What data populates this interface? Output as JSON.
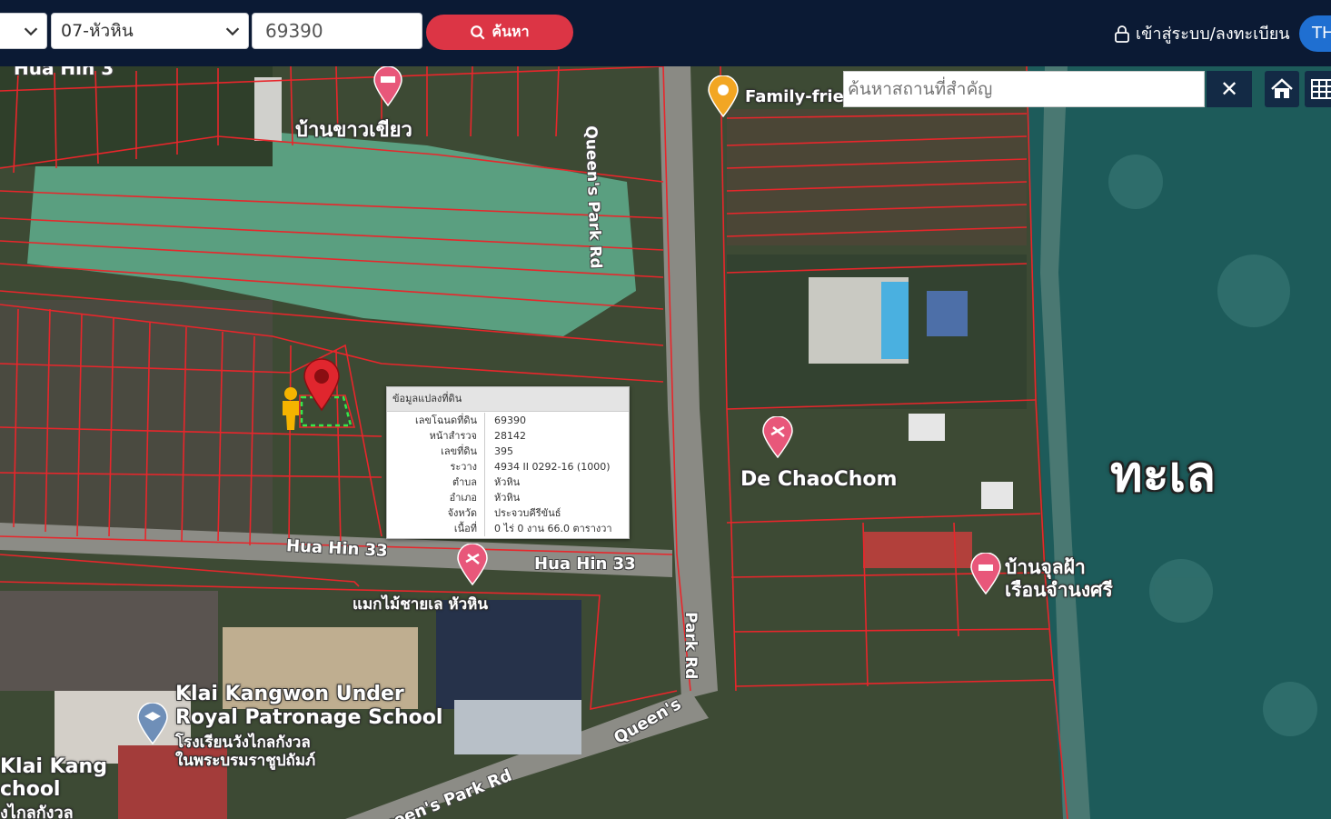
{
  "header": {
    "province_select": "",
    "district_select": "07-หัวหิน",
    "parcel_input_value": "69390",
    "search_button": "ค้นหา",
    "login_label": "เข้าสู่ระบบ/ลงทะเบียน",
    "lang_button": "TH"
  },
  "map": {
    "place_search_placeholder": "ค้นหาสถานที่สำคัญ",
    "place_clear": "✕",
    "sea_label": "ทะเล",
    "pois": [
      {
        "label": "บ้านขาวเขียว"
      },
      {
        "label": "Family-frien"
      },
      {
        "label": "De ChaoChom"
      },
      {
        "label": "บ้านจุลฝ้า"
      },
      {
        "label": "เรือนจำนงศรี"
      },
      {
        "label": "แมกไม้ชายเล หัวหิน"
      },
      {
        "label": "Klai Kangwon Under"
      },
      {
        "label": "Royal Patronage School"
      },
      {
        "label": "โรงเรียนวังไกลกังวล"
      },
      {
        "label": "ในพระบรมราชูปถัมภ์"
      },
      {
        "label": "Klai Kang"
      },
      {
        "label": "chool"
      },
      {
        "label": "งไกลกังวล"
      }
    ],
    "roads": [
      {
        "label": "Hua Hin 3"
      },
      {
        "label": "Queen's Park Rd"
      },
      {
        "label": "Hua Hin 33"
      },
      {
        "label": "Hua Hin 33"
      },
      {
        "label": "Park Rd"
      },
      {
        "label": "Queen's"
      },
      {
        "label": "Queen's Park Rd"
      }
    ]
  },
  "parcel_popup": {
    "title": "ข้อมูลแปลงที่ดิน",
    "rows": [
      {
        "key": "เลขโฉนดที่ดิน",
        "value": "69390"
      },
      {
        "key": "หน้าสำรวจ",
        "value": "28142"
      },
      {
        "key": "เลขที่ดิน",
        "value": "395"
      },
      {
        "key": "ระวาง",
        "value": "4934 II 0292-16 (1000)"
      },
      {
        "key": "ตำบล",
        "value": "หัวหิน"
      },
      {
        "key": "อำเภอ",
        "value": "หัวหิน"
      },
      {
        "key": "จังหวัด",
        "value": "ประจวบคีรีขันธ์"
      },
      {
        "key": "เนื้อที่",
        "value": "0 ไร่ 0 งาน 66.0 ตารางวา"
      }
    ]
  },
  "colors": {
    "topbar": "#0b1a34",
    "search_button": "#dc3545",
    "lang_button": "#1f6fd1",
    "parcel_lines": "#e8262b",
    "sea": "#1d5b5a",
    "poi_pin": "#e8577a",
    "location_pin": "#e0262e"
  }
}
